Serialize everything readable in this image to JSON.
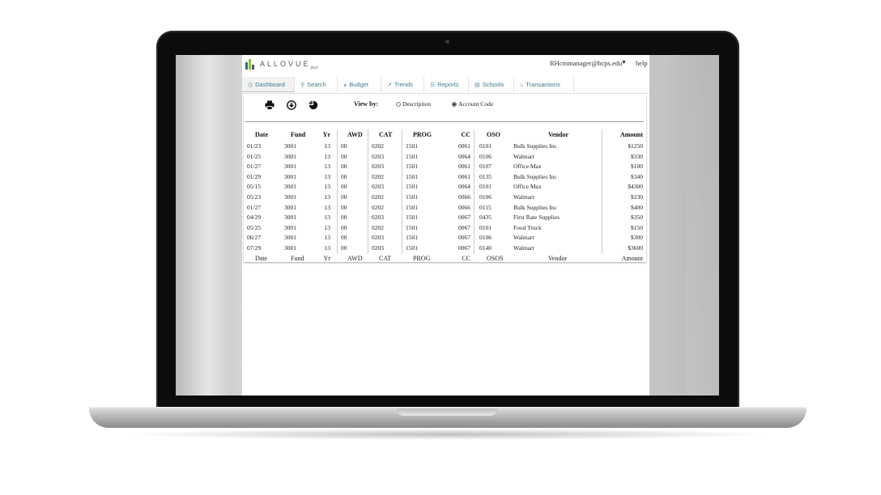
{
  "app": {
    "brand": "ALLOVUE",
    "brand_suffix": "plus",
    "user_email": "RHcmmanager@bcps.edu",
    "help_label": "help"
  },
  "colors": {
    "accent": "#3b7a8e",
    "logo": [
      "#2c6e8c",
      "#8bbf3b",
      "#555555"
    ]
  },
  "tabs": [
    {
      "label": "Dashboard",
      "icon": "clock-icon",
      "active": true
    },
    {
      "label": "Search",
      "icon": "search-icon"
    },
    {
      "label": "Budget",
      "icon": "pie-icon"
    },
    {
      "label": "Trends",
      "icon": "line-chart-icon"
    },
    {
      "label": "Reports",
      "icon": "list-icon"
    },
    {
      "label": "Schools",
      "icon": "table-icon"
    },
    {
      "label": "Transactions",
      "icon": "bank-icon"
    }
  ],
  "toolbar": {
    "print_icon": "printer-icon",
    "download_icon": "download-icon",
    "chart_icon": "pie-chart-icon",
    "view_by_label": "View by:",
    "options": [
      {
        "label": "Description",
        "selected": false
      },
      {
        "label": "Account Code",
        "selected": true
      }
    ]
  },
  "table": {
    "columns": [
      "Date",
      "Fund",
      "Yr",
      "AWD",
      "CAT",
      "PROG",
      "CC",
      "OSO",
      "Vendor",
      "Amount"
    ],
    "footer_columns": [
      "Date",
      "Fund",
      "Yr",
      "AWD",
      "CAT",
      "PROG",
      "CC",
      "OSOS",
      "Vendor",
      "Amount"
    ],
    "rows": [
      [
        "01/23",
        "3001",
        "13",
        "00",
        "0202",
        "1501",
        "0061",
        "0101",
        "Bulk Supplies Inc",
        "$1250"
      ],
      [
        "01/25",
        "3001",
        "13",
        "00",
        "0203",
        "1501",
        "0064",
        "0106",
        "Walmart",
        "$330"
      ],
      [
        "01/27",
        "3001",
        "13",
        "00",
        "0203",
        "1501",
        "0061",
        "0107",
        "Office Max",
        "$100"
      ],
      [
        "01/29",
        "3001",
        "13",
        "00",
        "0202",
        "1501",
        "0061",
        "0135",
        "Bulk Supplies Inc",
        "$340"
      ],
      [
        "05/15",
        "3001",
        "13",
        "00",
        "0203",
        "1501",
        "0064",
        "0101",
        "Office Max",
        "$4300"
      ],
      [
        "05/23",
        "3001",
        "13",
        "00",
        "0202",
        "1501",
        "0066",
        "0106",
        "Walmart",
        "$230"
      ],
      [
        "01/27",
        "3001",
        "13",
        "00",
        "0202",
        "1501",
        "0066",
        "0115",
        "Bulk Supplies Inc",
        "$400"
      ],
      [
        "04/29",
        "3001",
        "13",
        "00",
        "0203",
        "1501",
        "0067",
        "0435",
        "First Rate Supplies",
        "$350"
      ],
      [
        "05/25",
        "3001",
        "13",
        "00",
        "0202",
        "1501",
        "0067",
        "0101",
        "Food Truck",
        "$150"
      ],
      [
        "06/27",
        "3001",
        "13",
        "00",
        "0203",
        "1501",
        "0067",
        "0106",
        "Walmart",
        "$300"
      ],
      [
        "07/29",
        "3001",
        "13",
        "00",
        "0203",
        "1501",
        "0067",
        "0140",
        "Walmart",
        "$3600"
      ]
    ]
  }
}
